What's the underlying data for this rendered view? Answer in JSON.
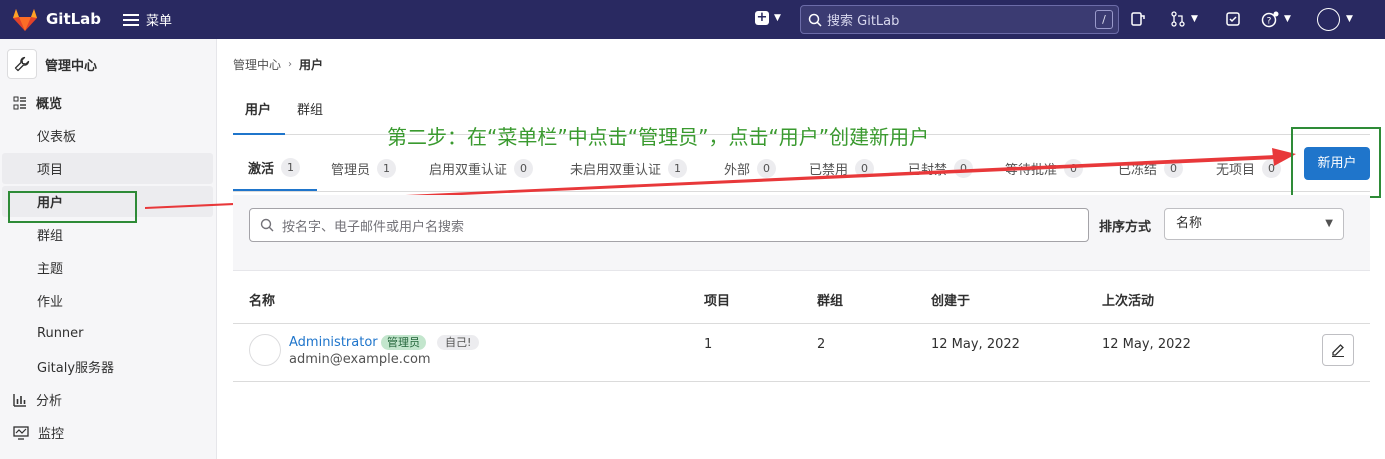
{
  "topbar": {
    "brand": "GitLab",
    "menu_label": "菜单",
    "search_placeholder": "搜索 GitLab",
    "search_shortcut": "/"
  },
  "sidebar": {
    "title": "管理中心",
    "sections": [
      {
        "label": "概览",
        "icon": "overview-icon"
      },
      {
        "label": "分析",
        "icon": "analytics-icon"
      },
      {
        "label": "监控",
        "icon": "monitor-icon"
      }
    ],
    "items": [
      "仪表板",
      "项目",
      "用户",
      "群组",
      "主题",
      "作业",
      "Runner",
      "Gitaly服务器"
    ]
  },
  "breadcrumb": {
    "parent": "管理中心",
    "current": "用户"
  },
  "main_tabs": [
    "用户",
    "群组"
  ],
  "annotation": "第二步：在“菜单栏”中点击“管理员”，点击“用户”创建新用户",
  "filter_tabs": [
    {
      "label": "激活",
      "count": "1"
    },
    {
      "label": "管理员",
      "count": "1"
    },
    {
      "label": "启用双重认证",
      "count": "0"
    },
    {
      "label": "未启用双重认证",
      "count": "1"
    },
    {
      "label": "外部",
      "count": "0"
    },
    {
      "label": "已禁用",
      "count": "0"
    },
    {
      "label": "已封禁",
      "count": "0"
    },
    {
      "label": "等待批准",
      "count": "0"
    },
    {
      "label": "已冻结",
      "count": "0"
    },
    {
      "label": "无项目",
      "count": "0"
    }
  ],
  "new_user_button": "新用户",
  "search": {
    "placeholder": "按名字、电子邮件或用户名搜索"
  },
  "sort": {
    "label": "排序方式",
    "value": "名称"
  },
  "table": {
    "headers": [
      "名称",
      "项目",
      "群组",
      "创建于",
      "上次活动"
    ],
    "rows": [
      {
        "name": "Administrator",
        "badge_admin": "管理员",
        "badge_self": "自己!",
        "email": "admin@example.com",
        "projects": "1",
        "groups": "2",
        "created": "12 May, 2022",
        "last_activity": "12 May, 2022"
      }
    ]
  },
  "colors": {
    "topbar": "#292961",
    "primary": "#1f75cb",
    "annotation": "#3a9a2f",
    "arrow": "#e8383a"
  }
}
